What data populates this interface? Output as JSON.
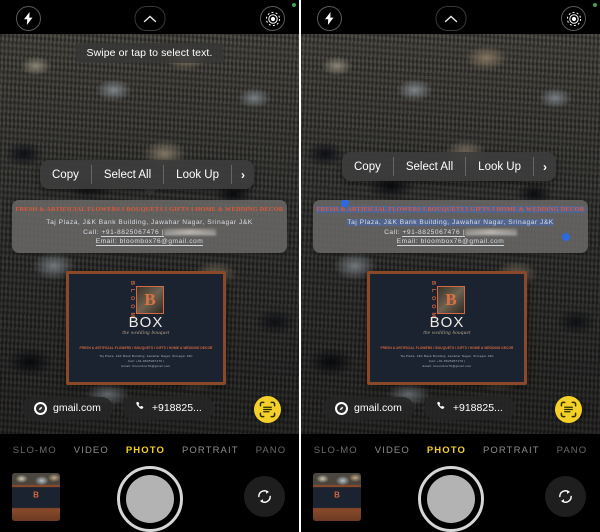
{
  "app": {
    "name": "Camera",
    "accent_yellow": "#F5D028",
    "selection_blue": "#2C6AE0",
    "menu_background": "rgba(60,60,60,0.93)"
  },
  "topbar": {
    "flash_icon": "flash-icon",
    "chevron_icon": "chevron-up-icon",
    "live_photo_icon": "live-photo-icon",
    "status_dot": "green-status-dot"
  },
  "hint": {
    "text": "Swipe or tap to select text."
  },
  "edit_menu": {
    "items": [
      {
        "label": "Copy",
        "name": "copy"
      },
      {
        "label": "Select All",
        "name": "select-all"
      },
      {
        "label": "Look Up",
        "name": "look-up"
      }
    ],
    "more_arrow": "›"
  },
  "recognized_text": {
    "header": "FRESH &  ARTIFICIAL FLOWERS I BOUQUETS I GIFTS I HOME & WEDDING  DECOR",
    "address": "Taj Plaza, J&K Bank Building, Jawahar Nagar, Srinagar J&K",
    "call_label": "Call: ",
    "call_number": "+91-8825067476 |",
    "email": "Email: bloombox76@gmail.com"
  },
  "business_card": {
    "brand_vertical": "B L O O M",
    "brand_letter": "B",
    "brand_word": "BOX",
    "tagline": "the wedding bouquet",
    "strip": "FRESH & ARTIFICIAL FLOWERS I BOUQUETS I GIFTS I HOME & WEDDING  DECOR",
    "lines": [
      "Taj Plaza, J&K Bank Building, Jawahar Nagar, Srinagar J&K",
      "Call: +91-8825067476 |",
      "Email: bloombox76@gmail.com"
    ]
  },
  "chips": {
    "email": {
      "label": "gmail.com",
      "icon": "safari-compass-icon"
    },
    "phone": {
      "label": "+918825...",
      "icon": "phone-icon"
    },
    "live_text_button": "live-text-scan-icon"
  },
  "mode_bar": {
    "modes": [
      {
        "label": "SLO-MO",
        "active": false,
        "edge": true
      },
      {
        "label": "VIDEO",
        "active": false,
        "edge": false
      },
      {
        "label": "PHOTO",
        "active": true,
        "edge": false
      },
      {
        "label": "PORTRAIT",
        "active": false,
        "edge": false
      },
      {
        "label": "PANO",
        "active": false,
        "edge": true
      }
    ]
  },
  "bottom_controls": {
    "thumbnail": "last-photo-thumbnail",
    "shutter": "shutter-button",
    "flip_camera": "flip-camera-icon"
  },
  "panels": [
    {
      "id": "left",
      "shows_hint": true,
      "has_selection": false,
      "menu_tail": true
    },
    {
      "id": "right",
      "shows_hint": false,
      "has_selection": true,
      "menu_tail": false
    }
  ]
}
